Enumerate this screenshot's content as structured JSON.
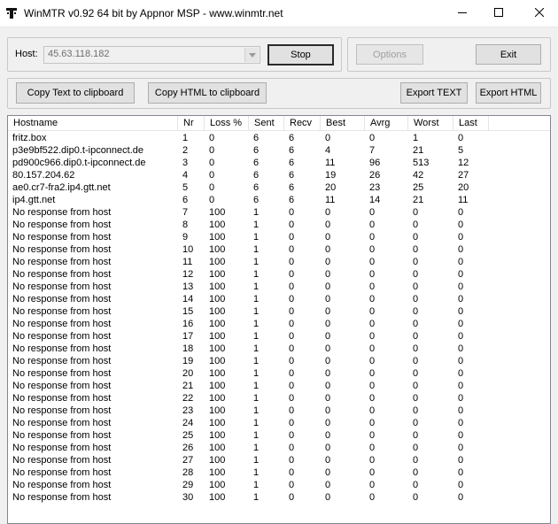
{
  "window": {
    "title": "WinMTR v0.92 64 bit by Appnor MSP - www.winmtr.net",
    "icon": "winmtr-app-icon"
  },
  "host": {
    "label": "Host:",
    "value": "45.63.118.182"
  },
  "buttons": {
    "stop": "Stop",
    "options": "Options",
    "exit": "Exit",
    "copy_text": "Copy Text to clipboard",
    "copy_html": "Copy HTML to clipboard",
    "export_text": "Export TEXT",
    "export_html": "Export HTML"
  },
  "table": {
    "columns": [
      "Hostname",
      "Nr",
      "Loss %",
      "Sent",
      "Recv",
      "Best",
      "Avrg",
      "Worst",
      "Last"
    ],
    "rows": [
      [
        "fritz.box",
        "1",
        "0",
        "6",
        "6",
        "0",
        "0",
        "1",
        "0"
      ],
      [
        "p3e9bf522.dip0.t-ipconnect.de",
        "2",
        "0",
        "6",
        "6",
        "4",
        "7",
        "21",
        "5"
      ],
      [
        "pd900c966.dip0.t-ipconnect.de",
        "3",
        "0",
        "6",
        "6",
        "11",
        "96",
        "513",
        "12"
      ],
      [
        "80.157.204.62",
        "4",
        "0",
        "6",
        "6",
        "19",
        "26",
        "42",
        "27"
      ],
      [
        "ae0.cr7-fra2.ip4.gtt.net",
        "5",
        "0",
        "6",
        "6",
        "20",
        "23",
        "25",
        "20"
      ],
      [
        "ip4.gtt.net",
        "6",
        "0",
        "6",
        "6",
        "11",
        "14",
        "21",
        "11"
      ],
      [
        "No response from host",
        "7",
        "100",
        "1",
        "0",
        "0",
        "0",
        "0",
        "0"
      ],
      [
        "No response from host",
        "8",
        "100",
        "1",
        "0",
        "0",
        "0",
        "0",
        "0"
      ],
      [
        "No response from host",
        "9",
        "100",
        "1",
        "0",
        "0",
        "0",
        "0",
        "0"
      ],
      [
        "No response from host",
        "10",
        "100",
        "1",
        "0",
        "0",
        "0",
        "0",
        "0"
      ],
      [
        "No response from host",
        "11",
        "100",
        "1",
        "0",
        "0",
        "0",
        "0",
        "0"
      ],
      [
        "No response from host",
        "12",
        "100",
        "1",
        "0",
        "0",
        "0",
        "0",
        "0"
      ],
      [
        "No response from host",
        "13",
        "100",
        "1",
        "0",
        "0",
        "0",
        "0",
        "0"
      ],
      [
        "No response from host",
        "14",
        "100",
        "1",
        "0",
        "0",
        "0",
        "0",
        "0"
      ],
      [
        "No response from host",
        "15",
        "100",
        "1",
        "0",
        "0",
        "0",
        "0",
        "0"
      ],
      [
        "No response from host",
        "16",
        "100",
        "1",
        "0",
        "0",
        "0",
        "0",
        "0"
      ],
      [
        "No response from host",
        "17",
        "100",
        "1",
        "0",
        "0",
        "0",
        "0",
        "0"
      ],
      [
        "No response from host",
        "18",
        "100",
        "1",
        "0",
        "0",
        "0",
        "0",
        "0"
      ],
      [
        "No response from host",
        "19",
        "100",
        "1",
        "0",
        "0",
        "0",
        "0",
        "0"
      ],
      [
        "No response from host",
        "20",
        "100",
        "1",
        "0",
        "0",
        "0",
        "0",
        "0"
      ],
      [
        "No response from host",
        "21",
        "100",
        "1",
        "0",
        "0",
        "0",
        "0",
        "0"
      ],
      [
        "No response from host",
        "22",
        "100",
        "1",
        "0",
        "0",
        "0",
        "0",
        "0"
      ],
      [
        "No response from host",
        "23",
        "100",
        "1",
        "0",
        "0",
        "0",
        "0",
        "0"
      ],
      [
        "No response from host",
        "24",
        "100",
        "1",
        "0",
        "0",
        "0",
        "0",
        "0"
      ],
      [
        "No response from host",
        "25",
        "100",
        "1",
        "0",
        "0",
        "0",
        "0",
        "0"
      ],
      [
        "No response from host",
        "26",
        "100",
        "1",
        "0",
        "0",
        "0",
        "0",
        "0"
      ],
      [
        "No response from host",
        "27",
        "100",
        "1",
        "0",
        "0",
        "0",
        "0",
        "0"
      ],
      [
        "No response from host",
        "28",
        "100",
        "1",
        "0",
        "0",
        "0",
        "0",
        "0"
      ],
      [
        "No response from host",
        "29",
        "100",
        "1",
        "0",
        "0",
        "0",
        "0",
        "0"
      ],
      [
        "No response from host",
        "30",
        "100",
        "1",
        "0",
        "0",
        "0",
        "0",
        "0"
      ]
    ]
  }
}
